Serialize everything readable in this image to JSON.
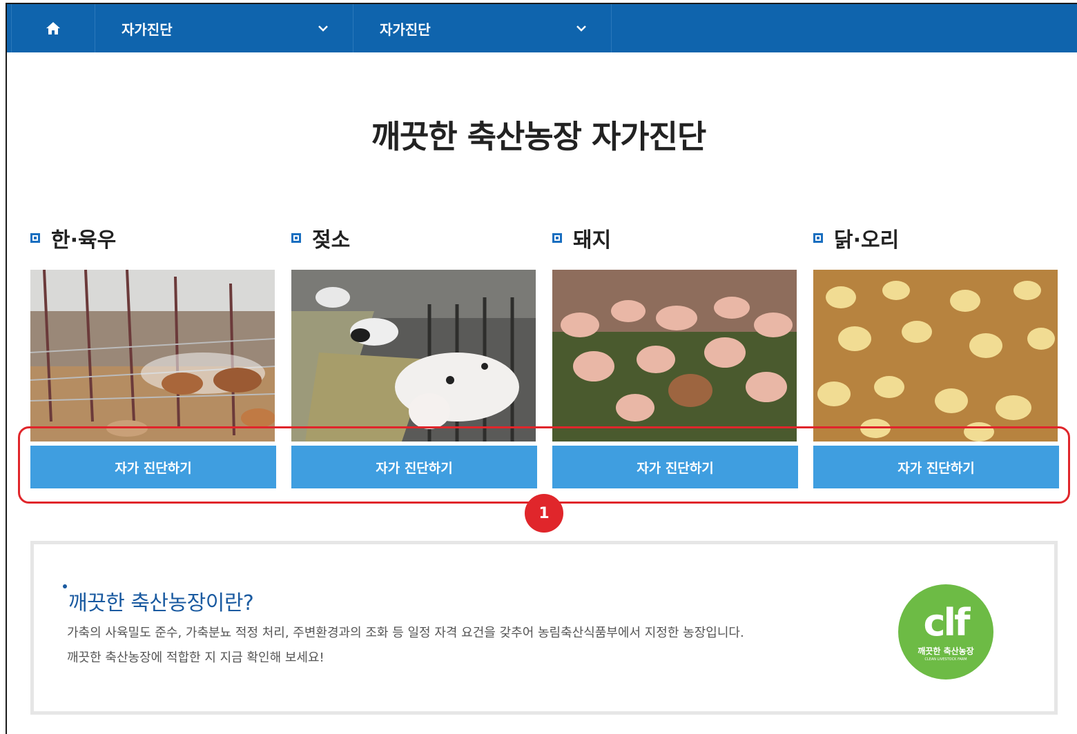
{
  "nav": {
    "home_icon": "home-icon",
    "dropdowns": [
      {
        "label": "자가진단"
      },
      {
        "label": "자가진단"
      }
    ]
  },
  "page": {
    "title": "깨끗한 축산농장 자가진단"
  },
  "categories": [
    {
      "name": "한·육우",
      "button": "자가 진단하기",
      "image": "cattle-photo"
    },
    {
      "name": "젖소",
      "button": "자가 진단하기",
      "image": "dairy-cow-photo"
    },
    {
      "name": "돼지",
      "button": "자가 진단하기",
      "image": "pig-photo"
    },
    {
      "name": "닭·오리",
      "button": "자가 진단하기",
      "image": "chick-photo"
    }
  ],
  "annotation": {
    "badge": "1"
  },
  "info": {
    "title": "깨끗한 축산농장이란?",
    "line1": "가축의 사육밀도 준수, 가축분뇨 적정 처리, 주변환경과의 조화 등 일정 자격 요건을 갖추어 농림축산식품부에서 지정한 농장입니다.",
    "line2": "깨끗한 축산농장에 적합한 지 지금 확인해 보세요!",
    "logo_main": "clf",
    "logo_sub": "깨끗한 축산농장",
    "logo_tiny": "CLEAN LIVESTOCK FARM"
  },
  "colors": {
    "nav_bg": "#0f64ad",
    "button_bg": "#3f9ee0",
    "highlight": "#e0262b",
    "logo_green": "#6dbb45"
  }
}
